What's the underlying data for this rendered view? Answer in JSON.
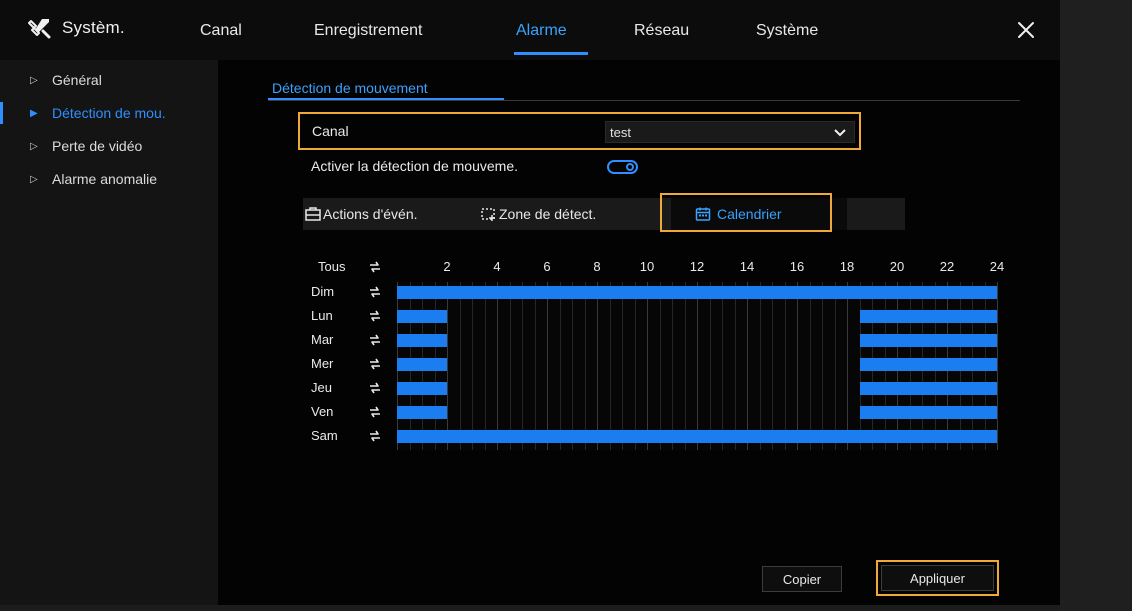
{
  "app": {
    "title": "Systèm."
  },
  "nav_tabs": [
    {
      "label": "Canal"
    },
    {
      "label": "Enregistrement"
    },
    {
      "label": "Alarme"
    },
    {
      "label": "Réseau"
    },
    {
      "label": "Système"
    }
  ],
  "active_tab": "Alarme",
  "sidebar": {
    "items": [
      {
        "label": "Général"
      },
      {
        "label": "Détection de mou."
      },
      {
        "label": "Perte de vidéo"
      },
      {
        "label": "Alarme anomalie"
      }
    ],
    "active": "Détection de mou."
  },
  "page": {
    "subtab": "Détection de mouvement",
    "canal_label": "Canal",
    "canal_value": "test",
    "enable_label": "Activer la détection de mouveme.",
    "enable_on": true
  },
  "event_tabs": [
    {
      "label": "Actions d'évén.",
      "icon": "event-actions-icon"
    },
    {
      "label": "Zone de détect.",
      "icon": "detection-zone-icon"
    },
    {
      "label": "Calendrier",
      "icon": "calendar-icon"
    }
  ],
  "selected_event_tab": "Calendrier",
  "schedule": {
    "all_label": "Tous",
    "hour_labels": [
      "2",
      "4",
      "6",
      "8",
      "10",
      "12",
      "14",
      "16",
      "18",
      "20",
      "22",
      "24"
    ],
    "days": [
      {
        "label": "Dim",
        "ranges": [
          [
            0,
            24
          ]
        ]
      },
      {
        "label": "Lun",
        "ranges": [
          [
            0,
            2
          ],
          [
            18.5,
            24
          ]
        ]
      },
      {
        "label": "Mar",
        "ranges": [
          [
            0,
            2
          ],
          [
            18.5,
            24
          ]
        ]
      },
      {
        "label": "Mer",
        "ranges": [
          [
            0,
            2
          ],
          [
            18.5,
            24
          ]
        ]
      },
      {
        "label": "Jeu",
        "ranges": [
          [
            0,
            2
          ],
          [
            18.5,
            24
          ]
        ]
      },
      {
        "label": "Ven",
        "ranges": [
          [
            0,
            2
          ],
          [
            18.5,
            24
          ]
        ]
      },
      {
        "label": "Sam",
        "ranges": [
          [
            0,
            24
          ]
        ]
      }
    ]
  },
  "buttons": {
    "copy": "Copier",
    "apply": "Appliquer"
  },
  "colors": {
    "accent": "#2f8fff",
    "highlight": "#f0a83a",
    "schedule_fill": "#1a7df0"
  }
}
